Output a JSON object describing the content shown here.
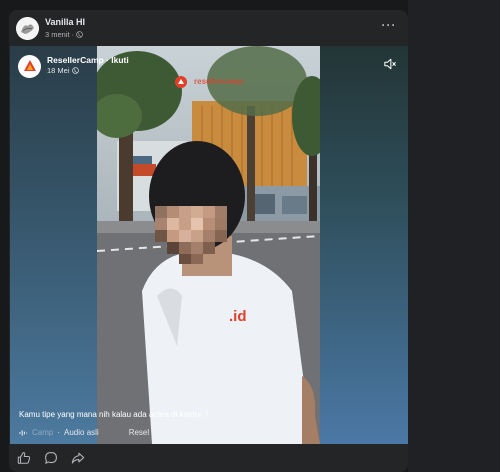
{
  "post": {
    "author": "Vanilla HI",
    "time": "3 menit",
    "privacy_icon": "globe-icon",
    "more_icon": "more-dots-icon",
    "more_label": "···"
  },
  "reel": {
    "author": "ResellerCamp",
    "separator": " · ",
    "follow_label": "Ikuti",
    "date": "18 Mei",
    "privacy_icon": "globe-icon",
    "mute_icon": "muted-speaker-icon",
    "caption": "Kamu tipe yang mana nih kalau ada acara di kantor ?",
    "audio_faded": "Camp",
    "audio_separator": " · ",
    "audio_label": "Audio asli",
    "audio_tail": "Resel"
  },
  "video": {
    "watermark": "resellercamp",
    "shirt_text": ".id"
  },
  "actions": [
    {
      "name": "like-button",
      "icon": "thumbs-up-icon"
    },
    {
      "name": "comment-button",
      "icon": "comment-bubble-icon"
    },
    {
      "name": "share-button",
      "icon": "share-arrow-icon"
    }
  ],
  "colors": {
    "background": "#18191a",
    "card": "#242526",
    "brand": "#e0402b"
  }
}
